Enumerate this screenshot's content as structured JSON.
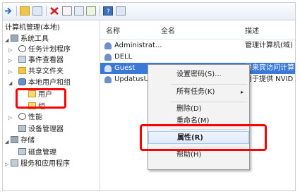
{
  "tree": {
    "root": "计算机管理(本地)",
    "items": [
      {
        "label": "系统工具"
      },
      {
        "label": "任务计划程序"
      },
      {
        "label": "事件查看器"
      },
      {
        "label": "共享文件夹"
      },
      {
        "label": "本地用户和组"
      },
      {
        "label": "用户"
      },
      {
        "label": "组"
      },
      {
        "label": "性能"
      },
      {
        "label": "设备管理器"
      },
      {
        "label": "存储"
      },
      {
        "label": "磁盘管理"
      },
      {
        "label": "服务和应用程序"
      }
    ]
  },
  "list": {
    "columns": [
      "名称",
      "全名",
      "描述"
    ],
    "rows": [
      {
        "name": "Administrat...",
        "desc": "管理计算机(域)"
      },
      {
        "name": "DELL",
        "desc": ""
      },
      {
        "name": "Guest",
        "desc": "供来宾访问计算"
      },
      {
        "name": "UpdatusUse",
        "desc": "用于提供 NVID"
      }
    ]
  },
  "context_menu": {
    "items": [
      {
        "label": "设置密码(S)..."
      },
      {
        "label": "所有任务(K)"
      },
      {
        "label": "删除(D)"
      },
      {
        "label": "重命名(M)"
      },
      {
        "label": "属性(R)"
      },
      {
        "label": "帮助(H)"
      }
    ],
    "submenu_arrow": "▸"
  },
  "colors": {
    "highlight": "#ff0000",
    "selection": "#3a79d8"
  }
}
